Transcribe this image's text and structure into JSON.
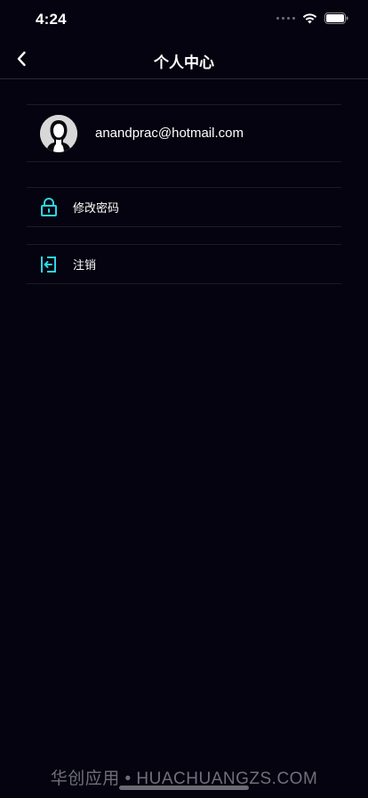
{
  "status_bar": {
    "time": "4:24"
  },
  "nav": {
    "title": "个人中心",
    "back_icon": "chevron-left-icon"
  },
  "profile": {
    "email": "anandprac@hotmail.com",
    "avatar_icon": "user-silhouette-icon"
  },
  "menu": {
    "items": [
      {
        "label": "修改密码",
        "icon": "lock-icon"
      },
      {
        "label": "注销",
        "icon": "logout-icon"
      }
    ]
  },
  "watermark": {
    "text": "华创应用 • HUACHUANGZS.COM"
  },
  "colors": {
    "background": "#04030f",
    "accent_icon": "#2fd3e8",
    "divider": "#1c1c26"
  }
}
